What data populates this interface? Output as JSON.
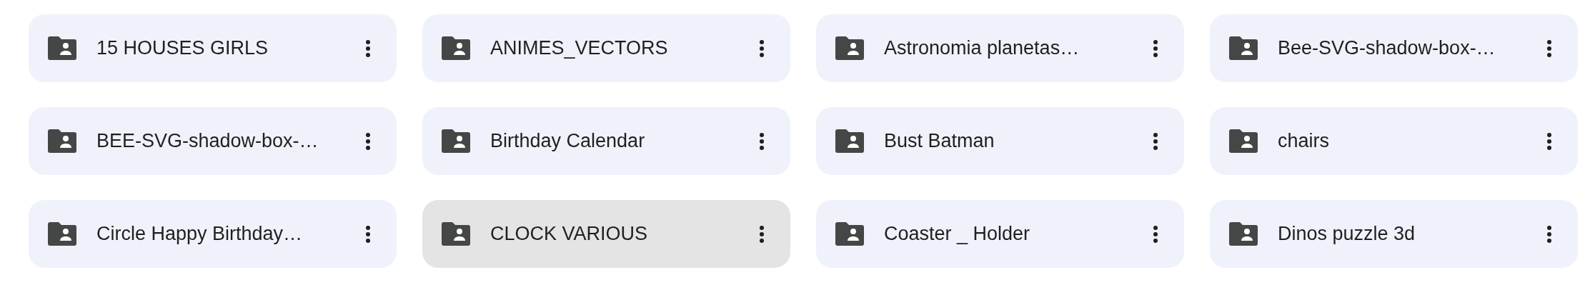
{
  "folders": [
    {
      "name": "15 HOUSES GIRLS",
      "highlighted": false
    },
    {
      "name": "ANIMES_VECTORS",
      "highlighted": false
    },
    {
      "name": "Astronomia planetas…",
      "highlighted": false
    },
    {
      "name": "Bee-SVG-shadow-box-…",
      "highlighted": false
    },
    {
      "name": "BEE-SVG-shadow-box-…",
      "highlighted": false
    },
    {
      "name": "Birthday Calendar",
      "highlighted": false
    },
    {
      "name": "Bust Batman",
      "highlighted": false
    },
    {
      "name": "chairs",
      "highlighted": false
    },
    {
      "name": "Circle Happy Birthday…",
      "highlighted": false
    },
    {
      "name": "CLOCK VARIOUS",
      "highlighted": true
    },
    {
      "name": "Coaster _ Holder",
      "highlighted": false
    },
    {
      "name": "Dinos puzzle 3d",
      "highlighted": false
    }
  ]
}
